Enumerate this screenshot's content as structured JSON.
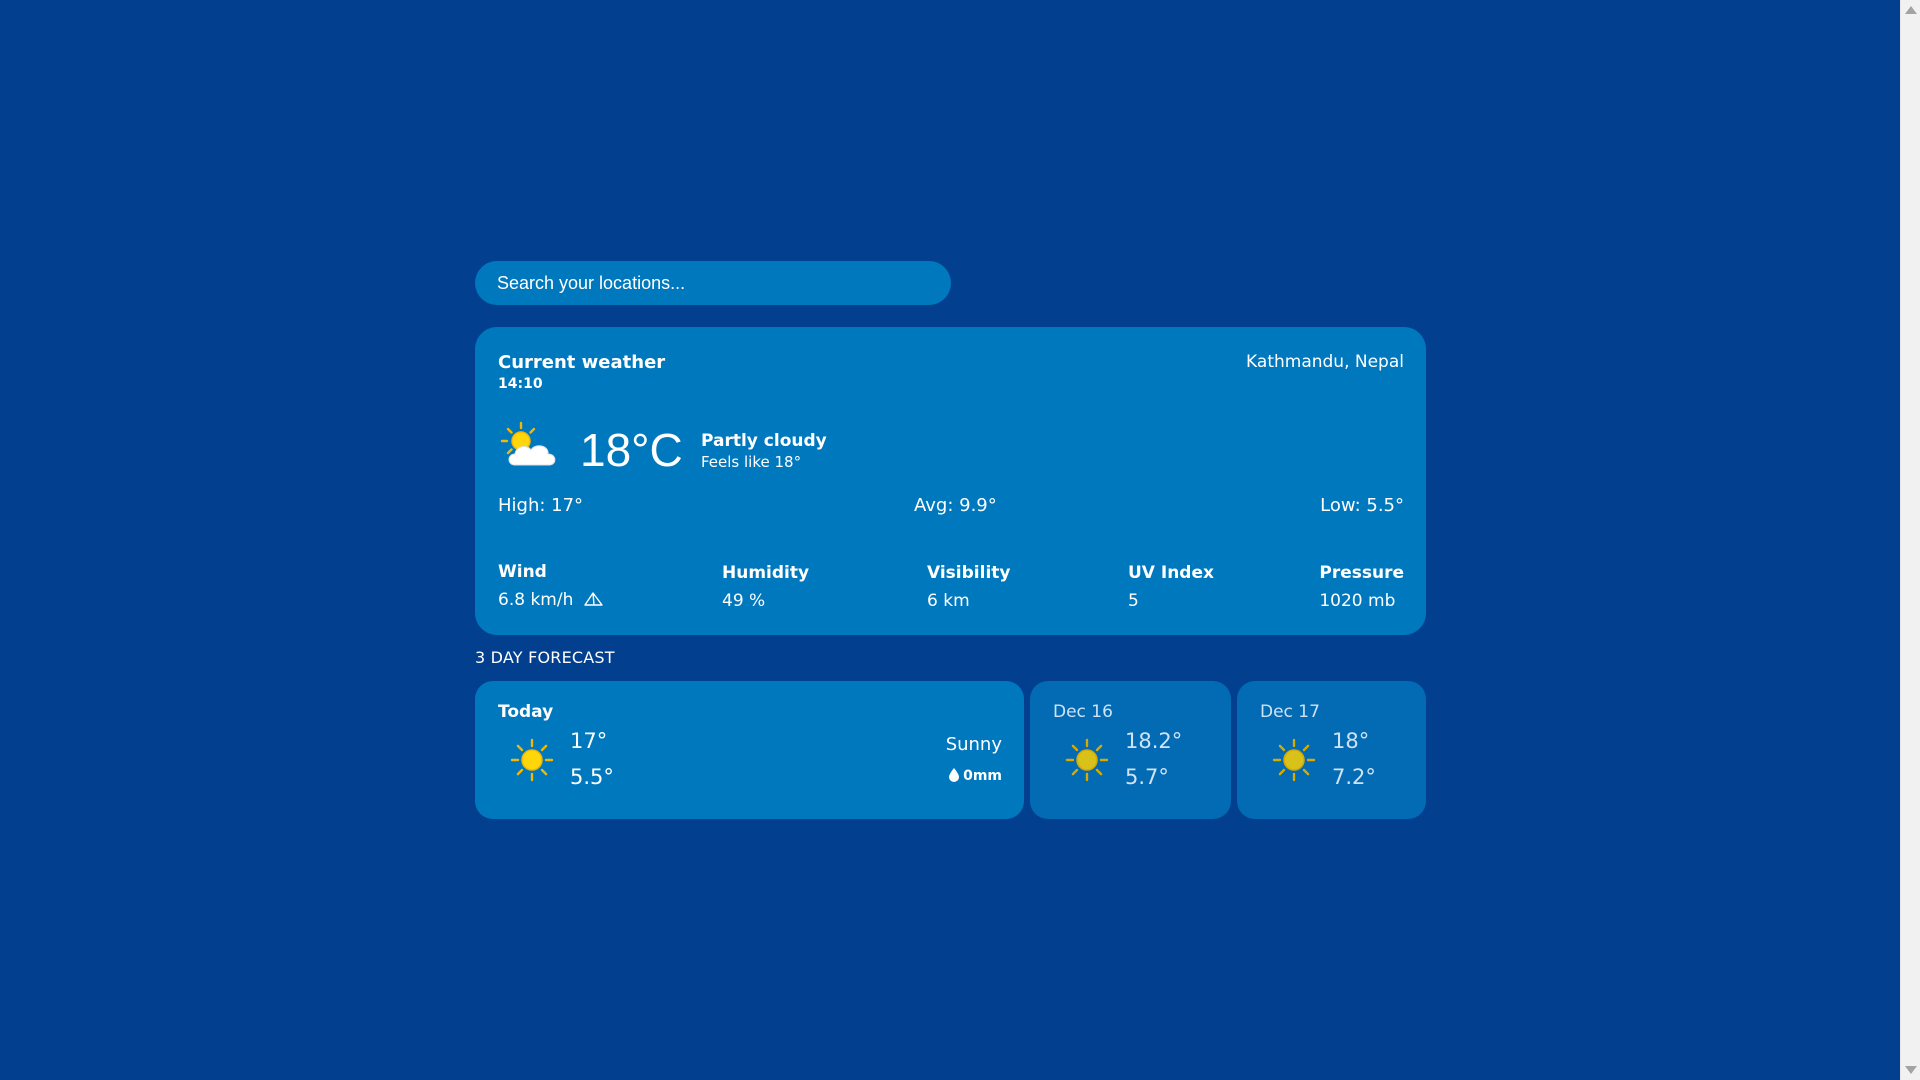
{
  "search": {
    "placeholder": "Search your locations..."
  },
  "current": {
    "title": "Current weather",
    "time": "14:10",
    "location": "Kathmandu, Nepal",
    "icon": "partly-cloudy-icon",
    "temperature": "18°C",
    "condition": "Partly cloudy",
    "feels_like": "Feels like 18°",
    "high": "High: 17°",
    "avg": "Avg: 9.9°",
    "low": "Low: 5.5°",
    "stats": {
      "wind": {
        "label": "Wind",
        "value": "6.8 km/h"
      },
      "humidity": {
        "label": "Humidity",
        "value": "49 %"
      },
      "visibility": {
        "label": "Visibility",
        "value": "6 km"
      },
      "uv": {
        "label": "UV Index",
        "value": "5"
      },
      "pressure": {
        "label": "Pressure",
        "value": "1020 mb"
      }
    }
  },
  "forecast": {
    "heading": "3 DAY FORECAST",
    "days": [
      {
        "day": "Today",
        "icon": "sun-icon",
        "high": "17°",
        "low": "5.5°",
        "condition": "Sunny",
        "rain": "0mm"
      },
      {
        "day": "Dec 16",
        "icon": "sun-icon",
        "high": "18.2°",
        "low": "5.7°"
      },
      {
        "day": "Dec 17",
        "icon": "sun-icon",
        "high": "18°",
        "low": "7.2°"
      }
    ]
  },
  "colors": {
    "background": "#02408f",
    "card": "#0078be",
    "card_secondary": "#036ab4",
    "sun": "#f5c400"
  }
}
